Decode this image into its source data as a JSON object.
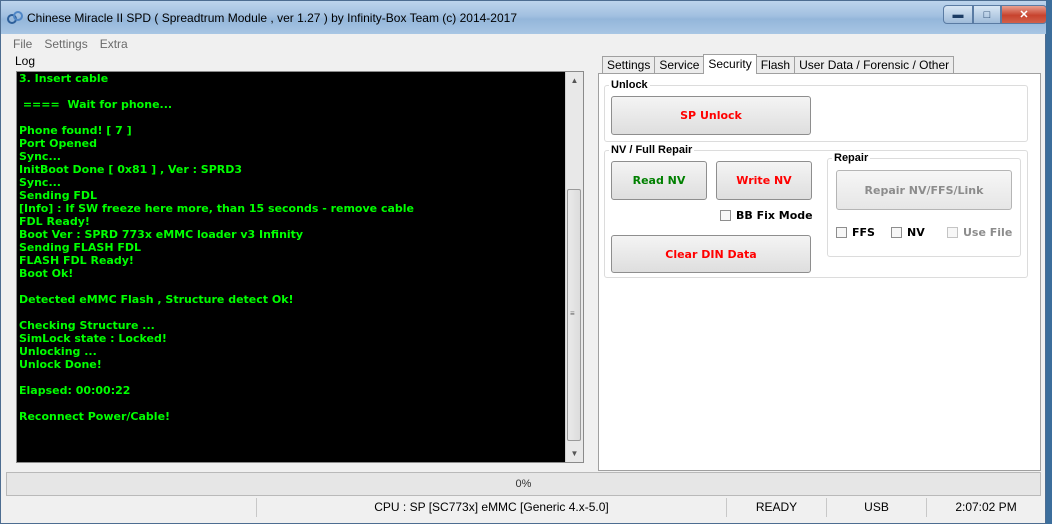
{
  "window": {
    "title": "Chinese Miracle II SPD ( Spreadtrum Module , ver 1.27 ) by Infinity-Box Team (c) 2014-2017"
  },
  "menu": [
    "File",
    "Settings",
    "Extra"
  ],
  "log": {
    "label": "Log",
    "lines": [
      "3. Insert cable",
      "",
      " ====  Wait for phone...",
      "",
      "Phone found! [ 7 ]",
      "Port Opened",
      "Sync...",
      "InitBoot Done [ 0x81 ] , Ver : SPRD3",
      "Sync...",
      "Sending FDL",
      "[Info] : If SW freeze here more, than 15 seconds - remove cable",
      "FDL Ready!",
      "Boot Ver : SPRD 773x eMMC loader v3 Infinity",
      "Sending FLASH FDL",
      "FLASH FDL Ready!",
      "Boot Ok!",
      "",
      "Detected eMMC Flash , Structure detect Ok!",
      "",
      "Checking Structure ...",
      "SimLock state : Locked!",
      "Unlocking ...",
      "Unlock Done!",
      "",
      "Elapsed: 00:00:22",
      "",
      "Reconnect Power/Cable!"
    ]
  },
  "tabs": [
    {
      "label": "Settings",
      "active": false
    },
    {
      "label": "Service",
      "active": false
    },
    {
      "label": "Security",
      "active": true
    },
    {
      "label": "Flash",
      "active": false
    },
    {
      "label": "User Data / Forensic / Other",
      "active": false
    }
  ],
  "security": {
    "unlock_group": "Unlock",
    "sp_unlock": "SP Unlock",
    "nv_group": "NV / Full Repair",
    "read_nv": "Read NV",
    "write_nv": "Write NV",
    "bb_fix_mode": "BB Fix Mode",
    "clear_din": "Clear DIN Data",
    "repair_group": "Repair",
    "repair_btn": "Repair NV/FFS/Link",
    "ffs": "FFS",
    "nv": "NV",
    "use_file": "Use File"
  },
  "progress": {
    "text": "0%",
    "value": 0
  },
  "status": {
    "cpu": "CPU : SP [SC773x] eMMC [Generic 4.x-5.0]",
    "state": "READY",
    "port": "USB",
    "time": "2:07:02 PM"
  },
  "colors": {
    "log_text": "#00ff00",
    "log_bg": "#000000",
    "red_label": "#ff0000",
    "green_label": "#008000"
  }
}
